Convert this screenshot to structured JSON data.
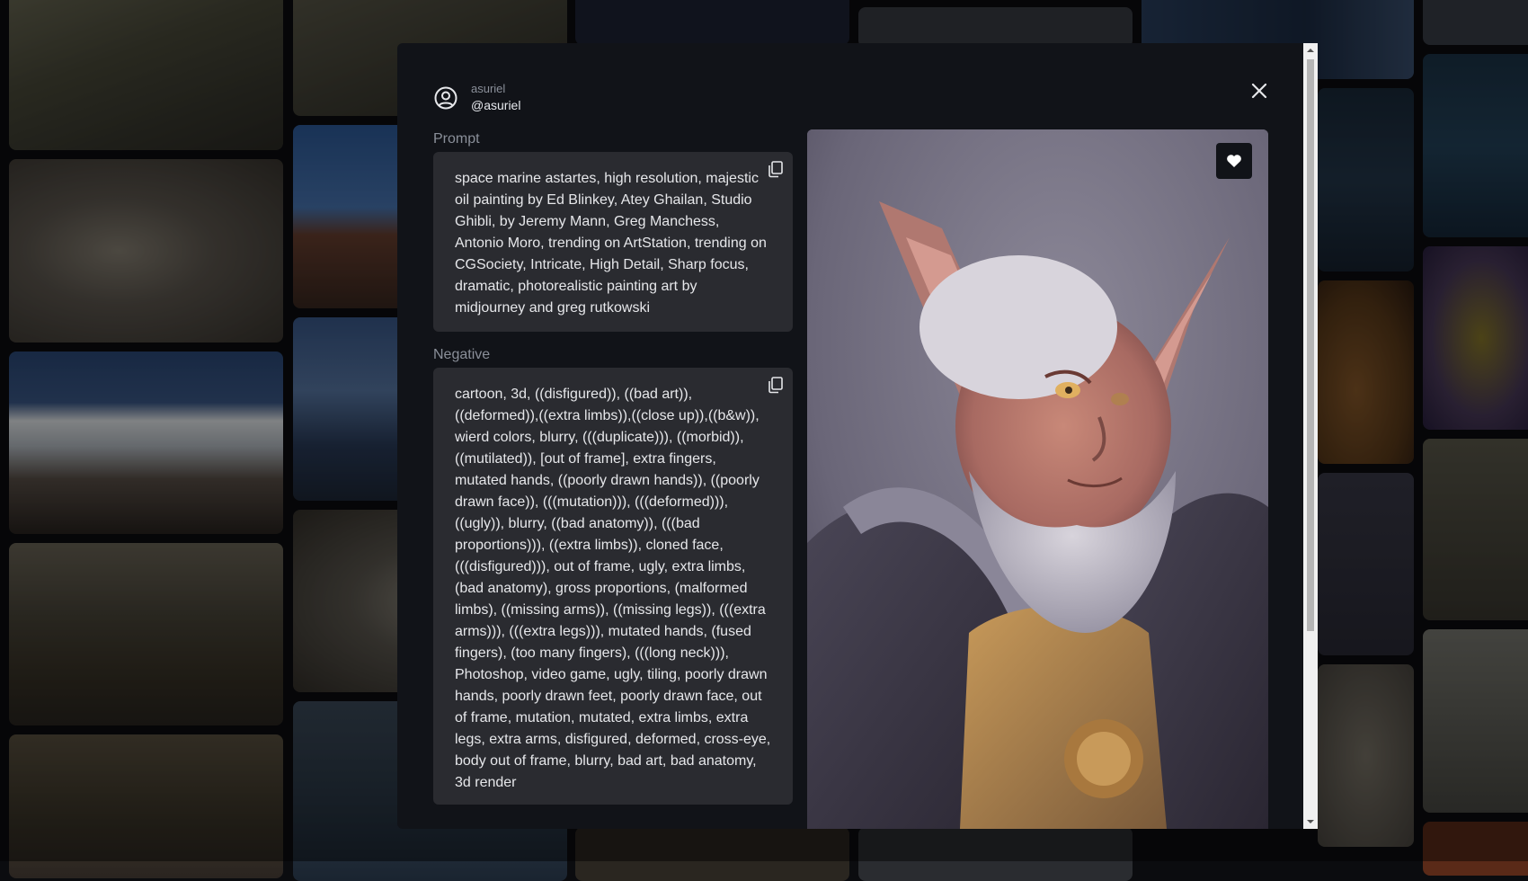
{
  "user": {
    "name": "asuriel",
    "handle": "@asuriel"
  },
  "prompt": {
    "label": "Prompt",
    "text": "space marine astartes, high resolution, majestic oil painting by Ed Blinkey, Atey Ghailan, Studio Ghibli, by Jeremy Mann, Greg Manchess, Antonio Moro, trending on ArtStation, trending on CGSociety, Intricate, High Detail, Sharp focus, dramatic, photorealistic painting art by midjourney and greg rutkowski"
  },
  "negative": {
    "label": "Negative",
    "text": "cartoon, 3d, ((disfigured)), ((bad art)), ((deformed)),((extra limbs)),((close up)),((b&w)), wierd colors, blurry, (((duplicate))), ((morbid)), ((mutilated)), [out of frame], extra fingers, mutated hands, ((poorly drawn hands)), ((poorly drawn face)), (((mutation))), (((deformed))), ((ugly)), blurry, ((bad anatomy)), (((bad proportions))), ((extra limbs)), cloned face, (((disfigured))), out of frame, ugly, extra limbs, (bad anatomy), gross proportions, (malformed limbs), ((missing arms)), ((missing legs)), (((extra arms))), (((extra legs))), mutated hands, (fused fingers), (too many fingers), (((long neck))), Photoshop, video game, ugly, tiling, poorly drawn hands, poorly drawn feet, poorly drawn face, out of frame, mutation, mutated, extra limbs, extra legs, extra arms, disfigured, deformed, cross-eye, body out of frame, blurry, bad art, bad anatomy, 3d render"
  },
  "icons": {
    "user": "user-circle-icon",
    "close": "close-icon",
    "copy": "copy-icon",
    "favorite": "heart-icon"
  },
  "colors": {
    "modal_bg": "#111318",
    "text_box_bg": "#2a2b30",
    "label": "#8a8f99",
    "text": "#e6e7ea"
  }
}
